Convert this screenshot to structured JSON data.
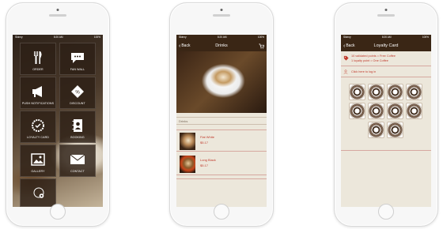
{
  "status": {
    "carrier": "Skinny",
    "time": "8:20 AM",
    "battery": "100%"
  },
  "screen1": {
    "tiles": [
      {
        "label": "ORDER",
        "icon": "fork-knife-icon"
      },
      {
        "label": "FAN WALL",
        "icon": "chat-bubble-icon"
      },
      {
        "label": "PUSH NOTIFICATIONS",
        "icon": "megaphone-icon"
      },
      {
        "label": "DISCOUNT",
        "icon": "discount-tag-icon"
      },
      {
        "label": "LOYALTY CARD",
        "icon": "loyalty-badge-icon"
      },
      {
        "label": "BOOKING",
        "icon": "address-book-icon"
      },
      {
        "label": "GALLERY",
        "icon": "image-icon"
      },
      {
        "label": "CONTACT",
        "icon": "envelope-icon"
      }
    ],
    "bottom_icon": "settings-gear-icon"
  },
  "screen2": {
    "nav": {
      "back": "Back",
      "title": "Drinks"
    },
    "section": "Drinks",
    "items": [
      {
        "name": "Flat White",
        "price": "$5.17"
      },
      {
        "name": "Long Black",
        "price": "$5.17"
      }
    ]
  },
  "screen3": {
    "nav": {
      "back": "Back",
      "title": "Loyalty Card"
    },
    "line1": "10 validated points = Free Coffee",
    "line2": "1 loyalty point = One Coffee",
    "login": "Click here to log in",
    "stamp_count": 10
  }
}
